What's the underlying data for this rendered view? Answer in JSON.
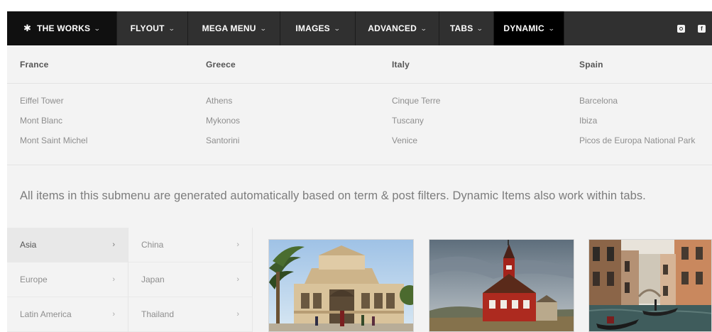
{
  "nav": {
    "items": [
      {
        "label": "THE WORKS",
        "icon": "gear-icon"
      },
      {
        "label": "FLYOUT"
      },
      {
        "label": "MEGA MENU"
      },
      {
        "label": "IMAGES"
      },
      {
        "label": "ADVANCED"
      },
      {
        "label": "TABS"
      },
      {
        "label": "DYNAMIC",
        "active": true
      }
    ],
    "social": [
      {
        "icon": "instagram-icon"
      },
      {
        "icon": "facebook-icon",
        "glyph": "f"
      }
    ]
  },
  "columns": [
    {
      "header": "France",
      "links": [
        "Eiffel Tower",
        "Mont Blanc",
        "Mont Saint Michel"
      ]
    },
    {
      "header": "Greece",
      "links": [
        "Athens",
        "Mykonos",
        "Santorini"
      ]
    },
    {
      "header": "Italy",
      "links": [
        "Cinque Terre",
        "Tuscany",
        "Venice"
      ]
    },
    {
      "header": "Spain",
      "links": [
        "Barcelona",
        "Ibiza",
        "Picos de Europa National Park"
      ]
    }
  ],
  "description": "All items in this submenu are generated automatically based on term & post filters. Dynamic Items also work within tabs.",
  "regions": [
    {
      "label": "Asia",
      "active": true
    },
    {
      "label": "Europe"
    },
    {
      "label": "Latin America"
    }
  ],
  "subregions": [
    {
      "label": "China"
    },
    {
      "label": "Japan"
    },
    {
      "label": "Thailand"
    }
  ],
  "thumbnails": [
    {
      "name": "building-photo"
    },
    {
      "name": "church-photo"
    },
    {
      "name": "venice-canal-photo"
    }
  ],
  "colors": {
    "navbar": "#303030",
    "active_tab": "#000000",
    "panel": "#f3f3f3"
  }
}
